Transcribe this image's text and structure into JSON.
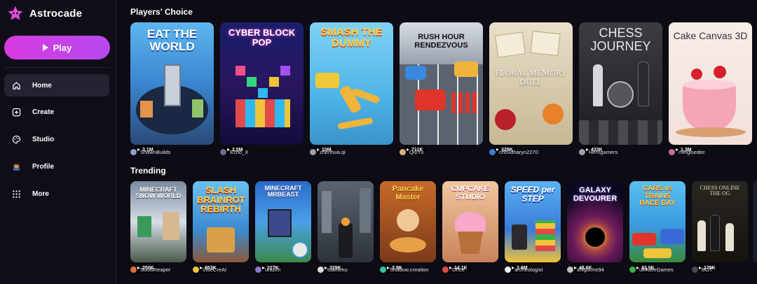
{
  "app": {
    "name": "Astrocade",
    "brand_color": "#e04fe0"
  },
  "sidebar": {
    "play_label": "Play",
    "items": [
      {
        "label": "Home",
        "icon": "home-icon",
        "active": true
      },
      {
        "label": "Create",
        "icon": "plus-square-icon"
      },
      {
        "label": "Studio",
        "icon": "palette-icon"
      },
      {
        "label": "Profile",
        "icon": "avatar-icon"
      },
      {
        "label": "More",
        "icon": "grid-dots-icon"
      }
    ]
  },
  "sections": {
    "players_choice": {
      "title": "Players' Choice",
      "games": [
        {
          "title": "EAT THE WORLD",
          "plays": "3.1M",
          "author": "ShawnBuilds"
        },
        {
          "title": "CYBER BLOCK POP",
          "plays": "2.5M",
          "author": "Echo_X"
        },
        {
          "title": "SMASH THE DUMMY",
          "plays": "10M",
          "author": "zhenhua.qi"
        },
        {
          "title": "RUSH HOUR RENDEZVOUS",
          "plays": "711K",
          "author": "QiuYu"
        },
        {
          "title": "FLORAL MEMORY DUEL",
          "plays": "328K",
          "author": "choudharyn2270"
        },
        {
          "title": "CHESS JOURNEY",
          "plays": "433K",
          "author": "Herogamers"
        },
        {
          "title": "Cake Canvas 3D",
          "plays": "1.3M",
          "author": "melgisedec"
        }
      ]
    },
    "trending": {
      "title": "Trending",
      "games": [
        {
          "title": "MINECRAFT SNOW WORLD",
          "plays": "250K",
          "author": "SoulsReaper"
        },
        {
          "title": "SLASH BRAINROT REBIRTH",
          "plays": "653K",
          "author": "VibeCreAI"
        },
        {
          "title": "MINECRAFT MRBEAST",
          "plays": "227K",
          "author": "urazim"
        },
        {
          "title": "",
          "plays": "329K",
          "author": "tuanteku"
        },
        {
          "title": "Pancake Master",
          "plays": "3.9K",
          "author": "Shadow.creation"
        },
        {
          "title": "CUPCAKE STUDIO",
          "plays": "14.1K",
          "author": "Ohce"
        },
        {
          "title": "SPEED per STEP",
          "plays": "3.6M",
          "author": "archeologist"
        },
        {
          "title": "GALAXY DEVOURER",
          "plays": "48.6K",
          "author": "shiguohe94"
        },
        {
          "title": "CARS vs TRAINS RACE DAY",
          "plays": "42.5K",
          "author": "uk4deeGames"
        },
        {
          "title": "CHESS ONLINE THE OG",
          "plays": "179K",
          "author": "BOT"
        }
      ]
    }
  }
}
